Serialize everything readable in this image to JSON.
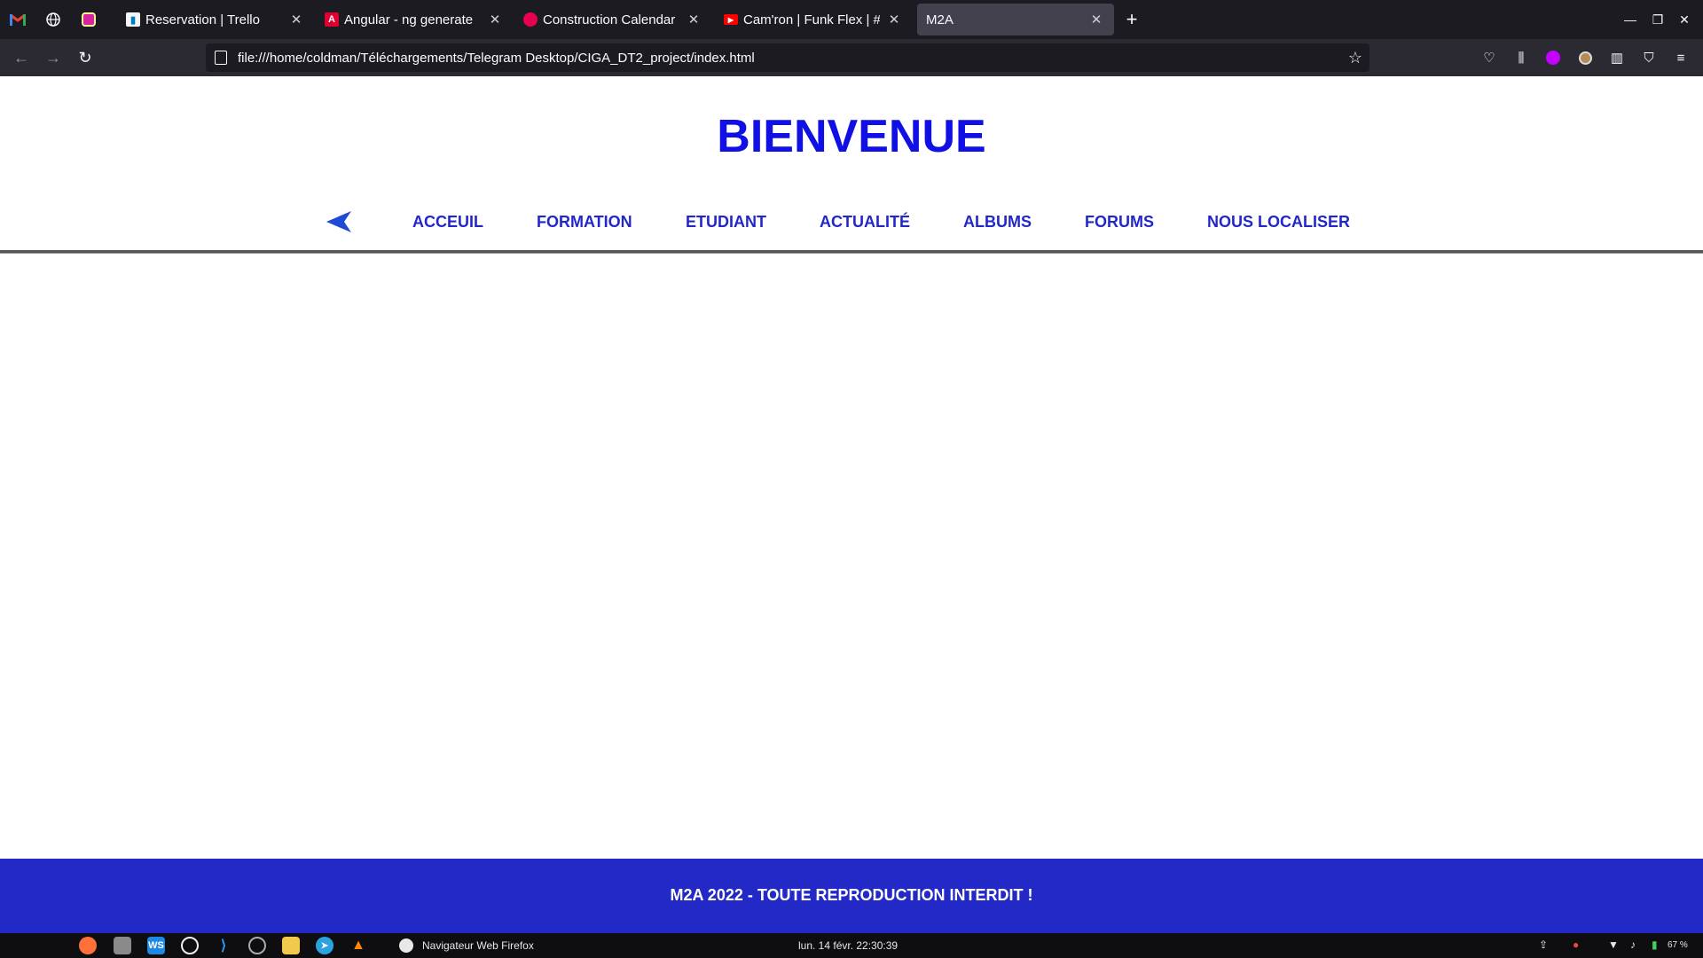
{
  "browser": {
    "pinned_tabs": [
      {
        "name": "gmail",
        "icon": "gmail-icon"
      },
      {
        "name": "web",
        "icon": "globe-icon"
      },
      {
        "name": "instagram",
        "icon": "instagram-icon"
      }
    ],
    "tabs": [
      {
        "title": "Reservation | Trello",
        "icon": "trello-icon",
        "color": "#f5f5f5"
      },
      {
        "title": "Angular - ng generate",
        "icon": "angular-icon",
        "color": "#dd0031"
      },
      {
        "title": "Construction Calendar by",
        "icon": "site-icon",
        "color": "#e60050"
      },
      {
        "title": "Cam'ron | Funk Flex | #F",
        "icon": "youtube-icon",
        "color": "#ff0000"
      },
      {
        "title": "M2A",
        "icon": "",
        "color": "",
        "active": true
      }
    ],
    "url": "file:///home/coldman/Téléchargements/Telegram Desktop/CIGA_DT2_project/index.html"
  },
  "page": {
    "title": "BIENVENUE",
    "nav": [
      "ACCEUIL",
      "FORMATION",
      "ETUDIANT",
      "ACTUALITÉ",
      "ALBUMS",
      "FORUMS",
      "NOUS LOCALISER"
    ],
    "footer": "M2A 2022 - TOUTE REPRODUCTION INTERDIT !"
  },
  "taskbar": {
    "window_title": "Navigateur Web Firefox",
    "clock": "lun. 14 févr. 22:30:39",
    "battery": "67 %"
  },
  "colors": {
    "title": "#1010e6",
    "nav_link": "#2327c8",
    "footer_bg": "#2229c7"
  }
}
